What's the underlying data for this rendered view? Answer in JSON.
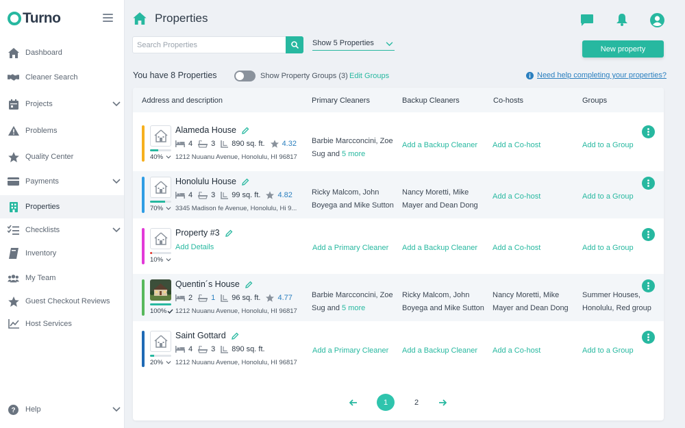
{
  "app": {
    "name": "Turno"
  },
  "sidebar": {
    "items": [
      {
        "label": "Dashboard",
        "icon": "home-icon"
      },
      {
        "label": "Cleaner Search",
        "icon": "handshake-icon"
      },
      {
        "label": "Projects",
        "icon": "calendar-icon",
        "expandable": true
      },
      {
        "label": "Problems",
        "icon": "warning-icon"
      },
      {
        "label": "Quality Center",
        "icon": "star-icon"
      },
      {
        "label": "Payments",
        "icon": "credit-card-icon",
        "expandable": true
      },
      {
        "label": "Properties",
        "icon": "building-icon",
        "active": true
      },
      {
        "label": "Checklists",
        "icon": "checklist-icon",
        "expandable": true
      },
      {
        "label": "Inventory",
        "icon": "inventory-icon"
      },
      {
        "label": "My Team",
        "icon": "team-icon"
      },
      {
        "label": "Guest Checkout Reviews",
        "icon": "star-review-icon"
      },
      {
        "label": "Host Services",
        "icon": "chart-line-icon"
      }
    ],
    "help": {
      "label": "Help",
      "icon": "help-icon"
    }
  },
  "header": {
    "title": "Properties",
    "icons": [
      "chat-icon",
      "bell-icon",
      "user-avatar-icon"
    ]
  },
  "toolbar": {
    "search_placeholder": "Search Properties",
    "search_value": "",
    "show_select": "Show 5 Properties",
    "new_property_label": "New property"
  },
  "summary": {
    "count_text": "You have 8 Properties",
    "toggle_label": "Show Property Groups (3)",
    "toggle_on": false,
    "edit_groups": "Edit Groups",
    "help_link": "Need help completing your properties?"
  },
  "table": {
    "columns": [
      "Address and description",
      "Primary Cleaners",
      "Backup Cleaners",
      "Co-hosts",
      "Groups"
    ],
    "rows": [
      {
        "name": "Alameda House",
        "color": "#f6b01e",
        "progress": 40,
        "progress_label": "40%",
        "progress_color": "#27b8a0",
        "beds": "4",
        "baths": "3",
        "area": "890 sq. ft.",
        "rating": "4.32",
        "address": "1212 Nuuanu Avenue, Honolulu, HI 96817",
        "primary_text": "Barbie Marcconcini, Zoe Sug and ",
        "primary_more": "5 more",
        "backup_link": "Add a Backup Cleaner",
        "cohost_link": "Add a Co-host",
        "group_link": "Add to a Group"
      },
      {
        "name": "Honolulu House",
        "color": "#2f9de4",
        "progress": 70,
        "progress_label": "70%",
        "progress_color": "#27b8a0",
        "beds": "4",
        "baths": "3",
        "area": "99 sq. ft.",
        "rating": "4.82",
        "address": "3345 Madison fe Avenue, Honolulu, Hi 9...",
        "primary_text": "Ricky Malcom, John Boyega and Mike Sutton",
        "backup_text": "Nancy Moretti, Mike Mayer and Dean Dong",
        "cohost_link": "Add a Co-host",
        "group_link": "Add to a Group"
      },
      {
        "name": "Property #3",
        "color": "#e23ad8",
        "progress": 10,
        "progress_label": "10%",
        "progress_color": "#e6463c",
        "add_details": "Add  Details",
        "primary_link": "Add a Primary Cleaner",
        "backup_link": "Add a Backup Cleaner",
        "cohost_link": "Add a Co-host",
        "group_link": "Add to a Group"
      },
      {
        "name": "Quentin´s House",
        "color": "#58b85c",
        "progress": 100,
        "progress_label": "100%",
        "progress_color": "#27b8a0",
        "beds": "2",
        "baths": "1",
        "area": "96 sq. ft.",
        "rating": "4.77",
        "address": "1212 Nuuanu Avenue, Honolulu, HI 96817",
        "primary_text": "Barbie Marcconcini, Zoe Sug and ",
        "primary_more": "5 more",
        "backup_text": "Ricky Malcom, John Boyega and Mike Sutton",
        "cohost_text": "Nancy Moretti, Mike Mayer and Dean Dong",
        "group_text": "Summer Houses, Honolulu, Red group"
      },
      {
        "name": "Saint Gottard",
        "color": "#1f6ab5",
        "progress": 20,
        "progress_label": "20%",
        "progress_color": "#27b8a0",
        "beds": "4",
        "baths": "3",
        "area": "890 sq. ft.",
        "address": "1212 Nuuanu Avenue, Honolulu, HI 96817",
        "primary_link": "Add a Primary Cleaner",
        "backup_link": "Add a Backup Cleaner",
        "cohost_link": "Add a Co-host",
        "group_link": "Add to a Group"
      }
    ]
  },
  "pagination": {
    "pages": [
      "1",
      "2"
    ],
    "current": "1"
  },
  "colors": {
    "accent": "#27b8a0",
    "link": "#2a7fbf"
  }
}
